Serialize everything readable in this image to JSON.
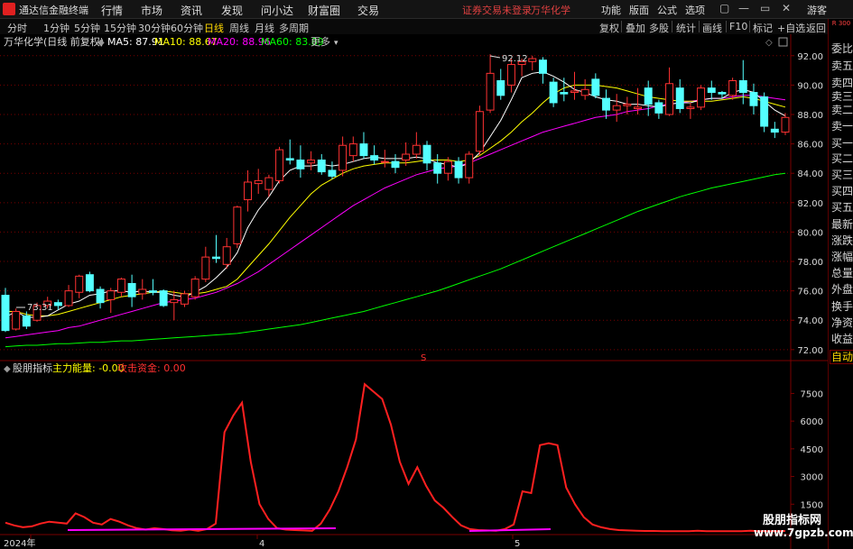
{
  "menubar": {
    "app_name": "通达信金融终端",
    "menus": [
      "行情",
      "市场",
      "资讯",
      "发现",
      "问小达",
      "财富圈",
      "交易"
    ],
    "status_text": "证券交易未登录",
    "stock_name": "万华化学",
    "right_menus": [
      "功能",
      "版面",
      "公式",
      "选项"
    ],
    "guest": "游客",
    "window_controls": [
      "▢",
      "—",
      "▭",
      "✕"
    ]
  },
  "toolbar": {
    "periods": [
      "分时",
      "1分钟",
      "5分钟",
      "15分钟",
      "30分钟",
      "60分钟",
      "日线",
      "周线",
      "月线",
      "多周期"
    ],
    "active_period": "日线",
    "right_buttons": [
      "复权",
      "叠加",
      "多股",
      "统计",
      "画线",
      "F10",
      "标记",
      "+自选",
      "返回"
    ]
  },
  "right_panel": {
    "top_tag": "R 300",
    "items": [
      "委比",
      "卖五",
      "卖四",
      "卖三",
      "卖二",
      "卖一",
      "买一",
      "买二",
      "买三",
      "买四",
      "买五",
      "最新",
      "涨跌",
      "涨幅",
      "总量",
      "外盘",
      "换手",
      "净资",
      "收益"
    ],
    "auto_button": "自动"
  },
  "main_legend": {
    "title": "万华化学(日线 前复权)",
    "ma5": "MA5: 87.91",
    "ma10": "MA10: 88.67",
    "ma20": "MA20: 88.96",
    "ma60": "MA60: 83.89",
    "more": "更多"
  },
  "indicator_legend": {
    "name": "股朋指标",
    "main_energy": "主力能量: -0.00",
    "attack_fund": "攻击资金: 0.00"
  },
  "annotations": {
    "high_label": "92.12",
    "low_label": "73.31",
    "marker_s": "S"
  },
  "x_axis": {
    "labels": [
      "2024年",
      "4",
      "5"
    ]
  },
  "watermark": {
    "line1": "股朋指标网",
    "line2": "www.7gpzb.com"
  },
  "colors": {
    "up": "#ff3232",
    "down": "#54ffff",
    "ma5": "#ffffff",
    "ma10": "#ffff00",
    "ma20": "#ff00ff",
    "ma60": "#00ff00",
    "indicator": "#ff2020",
    "indicator_base": "#ff00ff",
    "grid": "#7a0000"
  },
  "chart_data": [
    {
      "type": "candlestick",
      "title": "万华化学(日线 前复权)",
      "yticks": [
        72.0,
        74.0,
        76.0,
        78.0,
        80.0,
        82.0,
        84.0,
        86.0,
        88.0,
        90.0,
        92.0
      ],
      "ylim": [
        71.5,
        92.6
      ],
      "candles": [
        {
          "o": 75.7,
          "c": 73.3,
          "h": 76.2,
          "l": 73.2
        },
        {
          "o": 73.4,
          "c": 74.6,
          "h": 74.8,
          "l": 73.3
        },
        {
          "o": 74.3,
          "c": 73.6,
          "h": 74.6,
          "l": 73.4
        },
        {
          "o": 74.0,
          "c": 75.0,
          "h": 75.2,
          "l": 73.9
        },
        {
          "o": 75.0,
          "c": 75.3,
          "h": 75.6,
          "l": 74.8
        },
        {
          "o": 75.2,
          "c": 75.0,
          "h": 75.4,
          "l": 74.7
        },
        {
          "o": 75.0,
          "c": 76.0,
          "h": 76.4,
          "l": 74.9
        },
        {
          "o": 75.9,
          "c": 77.0,
          "h": 77.1,
          "l": 75.5
        },
        {
          "o": 77.1,
          "c": 76.0,
          "h": 77.3,
          "l": 75.9
        },
        {
          "o": 76.1,
          "c": 75.2,
          "h": 76.3,
          "l": 74.8
        },
        {
          "o": 75.4,
          "c": 76.0,
          "h": 76.2,
          "l": 74.5
        },
        {
          "o": 75.9,
          "c": 76.8,
          "h": 76.9,
          "l": 75.6
        },
        {
          "o": 76.5,
          "c": 75.6,
          "h": 77.1,
          "l": 74.9
        },
        {
          "o": 75.8,
          "c": 76.1,
          "h": 76.8,
          "l": 75.4
        },
        {
          "o": 76.0,
          "c": 75.9,
          "h": 76.8,
          "l": 75.7
        },
        {
          "o": 76.0,
          "c": 75.0,
          "h": 76.1,
          "l": 74.9
        },
        {
          "o": 75.2,
          "c": 75.4,
          "h": 76.0,
          "l": 74.0
        },
        {
          "o": 75.1,
          "c": 75.8,
          "h": 76.0,
          "l": 74.9
        },
        {
          "o": 75.6,
          "c": 76.8,
          "h": 77.0,
          "l": 75.4
        },
        {
          "o": 76.8,
          "c": 78.3,
          "h": 79.0,
          "l": 76.6
        },
        {
          "o": 78.3,
          "c": 78.2,
          "h": 79.8,
          "l": 77.9
        },
        {
          "o": 77.8,
          "c": 79.0,
          "h": 79.6,
          "l": 77.5
        },
        {
          "o": 79.2,
          "c": 81.7,
          "h": 81.8,
          "l": 78.9
        },
        {
          "o": 82.2,
          "c": 83.4,
          "h": 84.2,
          "l": 81.4
        },
        {
          "o": 83.3,
          "c": 83.5,
          "h": 84.3,
          "l": 82.6
        },
        {
          "o": 82.9,
          "c": 83.7,
          "h": 83.9,
          "l": 82.4
        },
        {
          "o": 83.5,
          "c": 85.6,
          "h": 85.8,
          "l": 83.3
        },
        {
          "o": 85.0,
          "c": 84.9,
          "h": 86.3,
          "l": 84.6
        },
        {
          "o": 84.9,
          "c": 84.3,
          "h": 85.9,
          "l": 83.7
        },
        {
          "o": 84.7,
          "c": 84.9,
          "h": 85.5,
          "l": 84.2
        },
        {
          "o": 84.9,
          "c": 84.1,
          "h": 85.3,
          "l": 83.9
        },
        {
          "o": 84.2,
          "c": 83.8,
          "h": 84.8,
          "l": 83.6
        },
        {
          "o": 84.2,
          "c": 85.9,
          "h": 86.5,
          "l": 83.8
        },
        {
          "o": 85.2,
          "c": 86.0,
          "h": 86.5,
          "l": 84.8
        },
        {
          "o": 86.0,
          "c": 85.2,
          "h": 86.8,
          "l": 85.0
        },
        {
          "o": 85.2,
          "c": 84.9,
          "h": 85.9,
          "l": 84.6
        },
        {
          "o": 84.8,
          "c": 84.8,
          "h": 85.6,
          "l": 84.4
        },
        {
          "o": 84.8,
          "c": 84.4,
          "h": 85.3,
          "l": 84.0
        },
        {
          "o": 84.9,
          "c": 85.3,
          "h": 86.1,
          "l": 84.5
        },
        {
          "o": 85.3,
          "c": 85.9,
          "h": 86.8,
          "l": 85.0
        },
        {
          "o": 85.9,
          "c": 84.7,
          "h": 86.2,
          "l": 84.2
        },
        {
          "o": 84.7,
          "c": 84.0,
          "h": 85.3,
          "l": 83.3
        },
        {
          "o": 84.0,
          "c": 84.8,
          "h": 85.1,
          "l": 83.5
        },
        {
          "o": 84.8,
          "c": 83.7,
          "h": 85.1,
          "l": 83.3
        },
        {
          "o": 83.7,
          "c": 85.3,
          "h": 85.5,
          "l": 83.3
        },
        {
          "o": 85.5,
          "c": 88.2,
          "h": 88.6,
          "l": 85.2
        },
        {
          "o": 88.3,
          "c": 90.8,
          "h": 92.1,
          "l": 88.1
        },
        {
          "o": 90.3,
          "c": 89.3,
          "h": 91.1,
          "l": 89.0
        },
        {
          "o": 90.0,
          "c": 91.4,
          "h": 91.8,
          "l": 89.5
        },
        {
          "o": 91.4,
          "c": 91.6,
          "h": 91.8,
          "l": 90.6
        },
        {
          "o": 91.6,
          "c": 91.8,
          "h": 92.0,
          "l": 91.0
        },
        {
          "o": 91.7,
          "c": 90.8,
          "h": 91.9,
          "l": 90.1
        },
        {
          "o": 90.2,
          "c": 88.8,
          "h": 90.5,
          "l": 88.5
        },
        {
          "o": 89.5,
          "c": 89.4,
          "h": 90.5,
          "l": 88.9
        },
        {
          "o": 89.5,
          "c": 89.6,
          "h": 90.9,
          "l": 89.0
        },
        {
          "o": 89.3,
          "c": 89.7,
          "h": 90.4,
          "l": 89.0
        },
        {
          "o": 90.4,
          "c": 89.3,
          "h": 90.8,
          "l": 89.1
        },
        {
          "o": 89.1,
          "c": 88.3,
          "h": 89.7,
          "l": 87.7
        },
        {
          "o": 88.3,
          "c": 88.6,
          "h": 89.4,
          "l": 87.5
        },
        {
          "o": 88.6,
          "c": 88.7,
          "h": 89.2,
          "l": 88.0
        },
        {
          "o": 88.4,
          "c": 88.5,
          "h": 89.8,
          "l": 88.0
        },
        {
          "o": 89.8,
          "c": 88.7,
          "h": 90.3,
          "l": 87.9
        },
        {
          "o": 88.8,
          "c": 88.1,
          "h": 89.0,
          "l": 87.7
        },
        {
          "o": 88.0,
          "c": 90.1,
          "h": 91.2,
          "l": 87.9
        },
        {
          "o": 89.8,
          "c": 88.4,
          "h": 90.4,
          "l": 88.1
        },
        {
          "o": 88.4,
          "c": 88.5,
          "h": 88.8,
          "l": 87.7
        },
        {
          "o": 88.5,
          "c": 89.8,
          "h": 90.0,
          "l": 88.3
        },
        {
          "o": 89.8,
          "c": 89.5,
          "h": 90.3,
          "l": 89.0
        },
        {
          "o": 89.5,
          "c": 89.4,
          "h": 89.6,
          "l": 89.1
        },
        {
          "o": 89.3,
          "c": 90.3,
          "h": 90.5,
          "l": 89.0
        },
        {
          "o": 90.3,
          "c": 89.5,
          "h": 91.7,
          "l": 88.7
        },
        {
          "o": 89.5,
          "c": 88.6,
          "h": 90.1,
          "l": 88.0
        },
        {
          "o": 89.2,
          "c": 87.2,
          "h": 89.5,
          "l": 86.8
        },
        {
          "o": 87.0,
          "c": 86.8,
          "h": 87.5,
          "l": 86.4
        },
        {
          "o": 86.8,
          "c": 87.8,
          "h": 88.1,
          "l": 86.6
        }
      ],
      "ma5": [
        74.2,
        74.6,
        74.2,
        74.2,
        74.3,
        74.7,
        75.1,
        75.3,
        75.7,
        75.8,
        76.0,
        76.0,
        75.9,
        76.0,
        75.9,
        75.9,
        75.7,
        75.6,
        75.9,
        76.3,
        76.9,
        77.6,
        78.6,
        80.3,
        81.5,
        82.4,
        83.5,
        84.2,
        84.5,
        84.5,
        84.6,
        84.5,
        84.6,
        84.8,
        85.0,
        85.1,
        85.0,
        85.0,
        85.0,
        85.1,
        85.0,
        84.7,
        84.6,
        84.4,
        84.7,
        85.4,
        86.5,
        87.6,
        89.0,
        90.5,
        90.8,
        90.9,
        90.6,
        90.2,
        89.7,
        89.5,
        89.2,
        89.0,
        88.9,
        88.7,
        88.7,
        88.6,
        88.5,
        88.7,
        88.8,
        88.8,
        89.0,
        89.1,
        89.1,
        89.5,
        89.7,
        89.5,
        88.9,
        88.3,
        87.9
      ],
      "ma10": [
        74.6,
        74.6,
        74.4,
        74.3,
        74.3,
        74.4,
        74.6,
        74.8,
        75.0,
        75.2,
        75.4,
        75.6,
        75.7,
        75.8,
        75.9,
        76.0,
        75.9,
        75.8,
        75.8,
        75.9,
        76.1,
        76.3,
        76.8,
        77.6,
        78.4,
        79.2,
        80.1,
        81.0,
        81.8,
        82.6,
        83.2,
        83.6,
        84.0,
        84.3,
        84.5,
        84.6,
        84.7,
        84.7,
        84.7,
        84.8,
        84.9,
        84.9,
        84.9,
        84.8,
        84.9,
        85.2,
        85.7,
        86.2,
        86.8,
        87.5,
        88.1,
        88.8,
        89.4,
        89.8,
        90.0,
        90.0,
        90.0,
        89.9,
        89.8,
        89.6,
        89.4,
        89.2,
        89.1,
        89.0,
        88.9,
        88.9,
        88.9,
        88.9,
        89.0,
        89.1,
        89.2,
        89.1,
        88.9,
        88.7,
        88.5
      ],
      "ma20": [
        72.8,
        72.9,
        73.0,
        73.1,
        73.2,
        73.3,
        73.5,
        73.6,
        73.8,
        74.0,
        74.2,
        74.4,
        74.6,
        74.8,
        75.0,
        75.2,
        75.3,
        75.4,
        75.5,
        75.7,
        75.9,
        76.2,
        76.5,
        76.9,
        77.3,
        77.8,
        78.3,
        78.8,
        79.3,
        79.8,
        80.3,
        80.8,
        81.3,
        81.8,
        82.2,
        82.6,
        83.0,
        83.3,
        83.6,
        83.9,
        84.1,
        84.3,
        84.4,
        84.5,
        84.7,
        85.0,
        85.3,
        85.6,
        85.9,
        86.2,
        86.5,
        86.8,
        87.0,
        87.2,
        87.4,
        87.6,
        87.8,
        87.9,
        88.0,
        88.2,
        88.3,
        88.4,
        88.6,
        88.7,
        88.8,
        88.9,
        89.0,
        89.1,
        89.1,
        89.2,
        89.3,
        89.3,
        89.2,
        89.1,
        89.0
      ],
      "ma60": [
        72.2,
        72.25,
        72.3,
        72.3,
        72.35,
        72.4,
        72.4,
        72.45,
        72.5,
        72.5,
        72.55,
        72.6,
        72.6,
        72.65,
        72.7,
        72.75,
        72.8,
        72.85,
        72.9,
        72.95,
        73.0,
        73.05,
        73.1,
        73.2,
        73.3,
        73.4,
        73.5,
        73.6,
        73.7,
        73.85,
        74.0,
        74.15,
        74.3,
        74.45,
        74.6,
        74.8,
        75.0,
        75.2,
        75.4,
        75.6,
        75.8,
        76.0,
        76.25,
        76.5,
        76.75,
        77.0,
        77.25,
        77.5,
        77.8,
        78.1,
        78.4,
        78.7,
        79.0,
        79.3,
        79.6,
        79.9,
        80.2,
        80.5,
        80.8,
        81.1,
        81.4,
        81.65,
        81.9,
        82.15,
        82.4,
        82.6,
        82.8,
        83.0,
        83.15,
        83.3,
        83.45,
        83.6,
        83.75,
        83.9,
        84.0
      ]
    },
    {
      "type": "line",
      "title": "股朋指标",
      "yticks": [
        1500,
        3000,
        4500,
        6000,
        7500
      ],
      "ylim": [
        0,
        8400
      ],
      "series": [
        {
          "name": "主力能量",
          "values": [
            500,
            350,
            250,
            300,
            450,
            550,
            500,
            450,
            1000,
            800,
            500,
            400,
            700,
            550,
            350,
            200,
            120,
            200,
            150,
            90,
            60,
            120,
            60,
            150,
            450,
            5400,
            6300,
            7000,
            3800,
            1500,
            700,
            200,
            120,
            100,
            80,
            60,
            450,
            1200,
            2200,
            3500,
            5000,
            8000,
            7600,
            7200,
            5800,
            3800,
            2600,
            3500,
            2500,
            1700,
            1300,
            800,
            350,
            150,
            100,
            80,
            60,
            150,
            400,
            2200,
            2100,
            4700,
            4800,
            4700,
            2400,
            1500,
            800,
            400,
            250,
            150,
            100,
            80,
            60,
            50,
            50,
            40,
            40,
            40,
            40,
            60,
            40,
            40,
            40,
            40,
            40,
            60,
            40,
            40,
            40,
            50
          ]
        }
      ]
    }
  ]
}
